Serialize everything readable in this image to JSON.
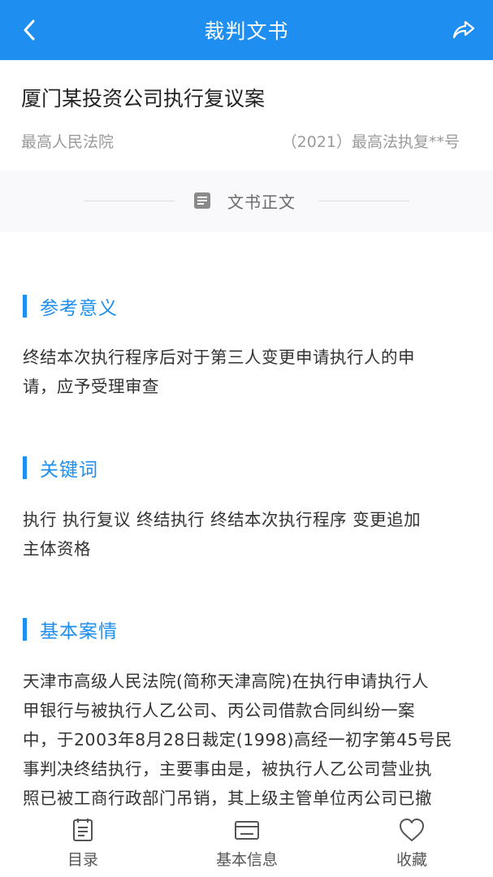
{
  "header": {
    "title": "裁判文书",
    "back_icon": "chevron-left-icon",
    "share_icon": "share-icon"
  },
  "case": {
    "title": "厦门某投资公司执行复议案",
    "court": "最高人民法院",
    "number": "（2021）最高法执复**号"
  },
  "divider": {
    "icon": "document-icon",
    "label": "文书正文"
  },
  "sections": [
    {
      "title": "参考意义",
      "lines": [
        "终结本次执行程序后对于第三人变更申请执行人的申",
        "请，应予受理审查"
      ]
    },
    {
      "title": "关键词",
      "lines": [
        "执行 执行复议 终结执行 终结本次执行程序 变更追加",
        "主体资格"
      ]
    },
    {
      "title": "基本案情",
      "lines": [
        "天津市高级人民法院(简称天津高院)在执行申请执行人",
        "甲银行与被执行人乙公司、丙公司借款合同纠纷一案",
        "中，于2003年8月28日裁定(1998)高经一初字第45号民",
        "事判决终结执行，主要事由是，被执行人乙公司营业执",
        "照已被工商行政部门吊销，其上级主管单位丙公司已撤"
      ]
    }
  ],
  "bottom_nav": [
    {
      "label": "目录",
      "icon": "catalog-icon"
    },
    {
      "label": "基本信息",
      "icon": "info-card-icon"
    },
    {
      "label": "收藏",
      "icon": "heart-icon"
    }
  ],
  "colors": {
    "brand": "#1e8ef0",
    "muted_text": "#9a9a9a",
    "body_text": "#333333"
  }
}
